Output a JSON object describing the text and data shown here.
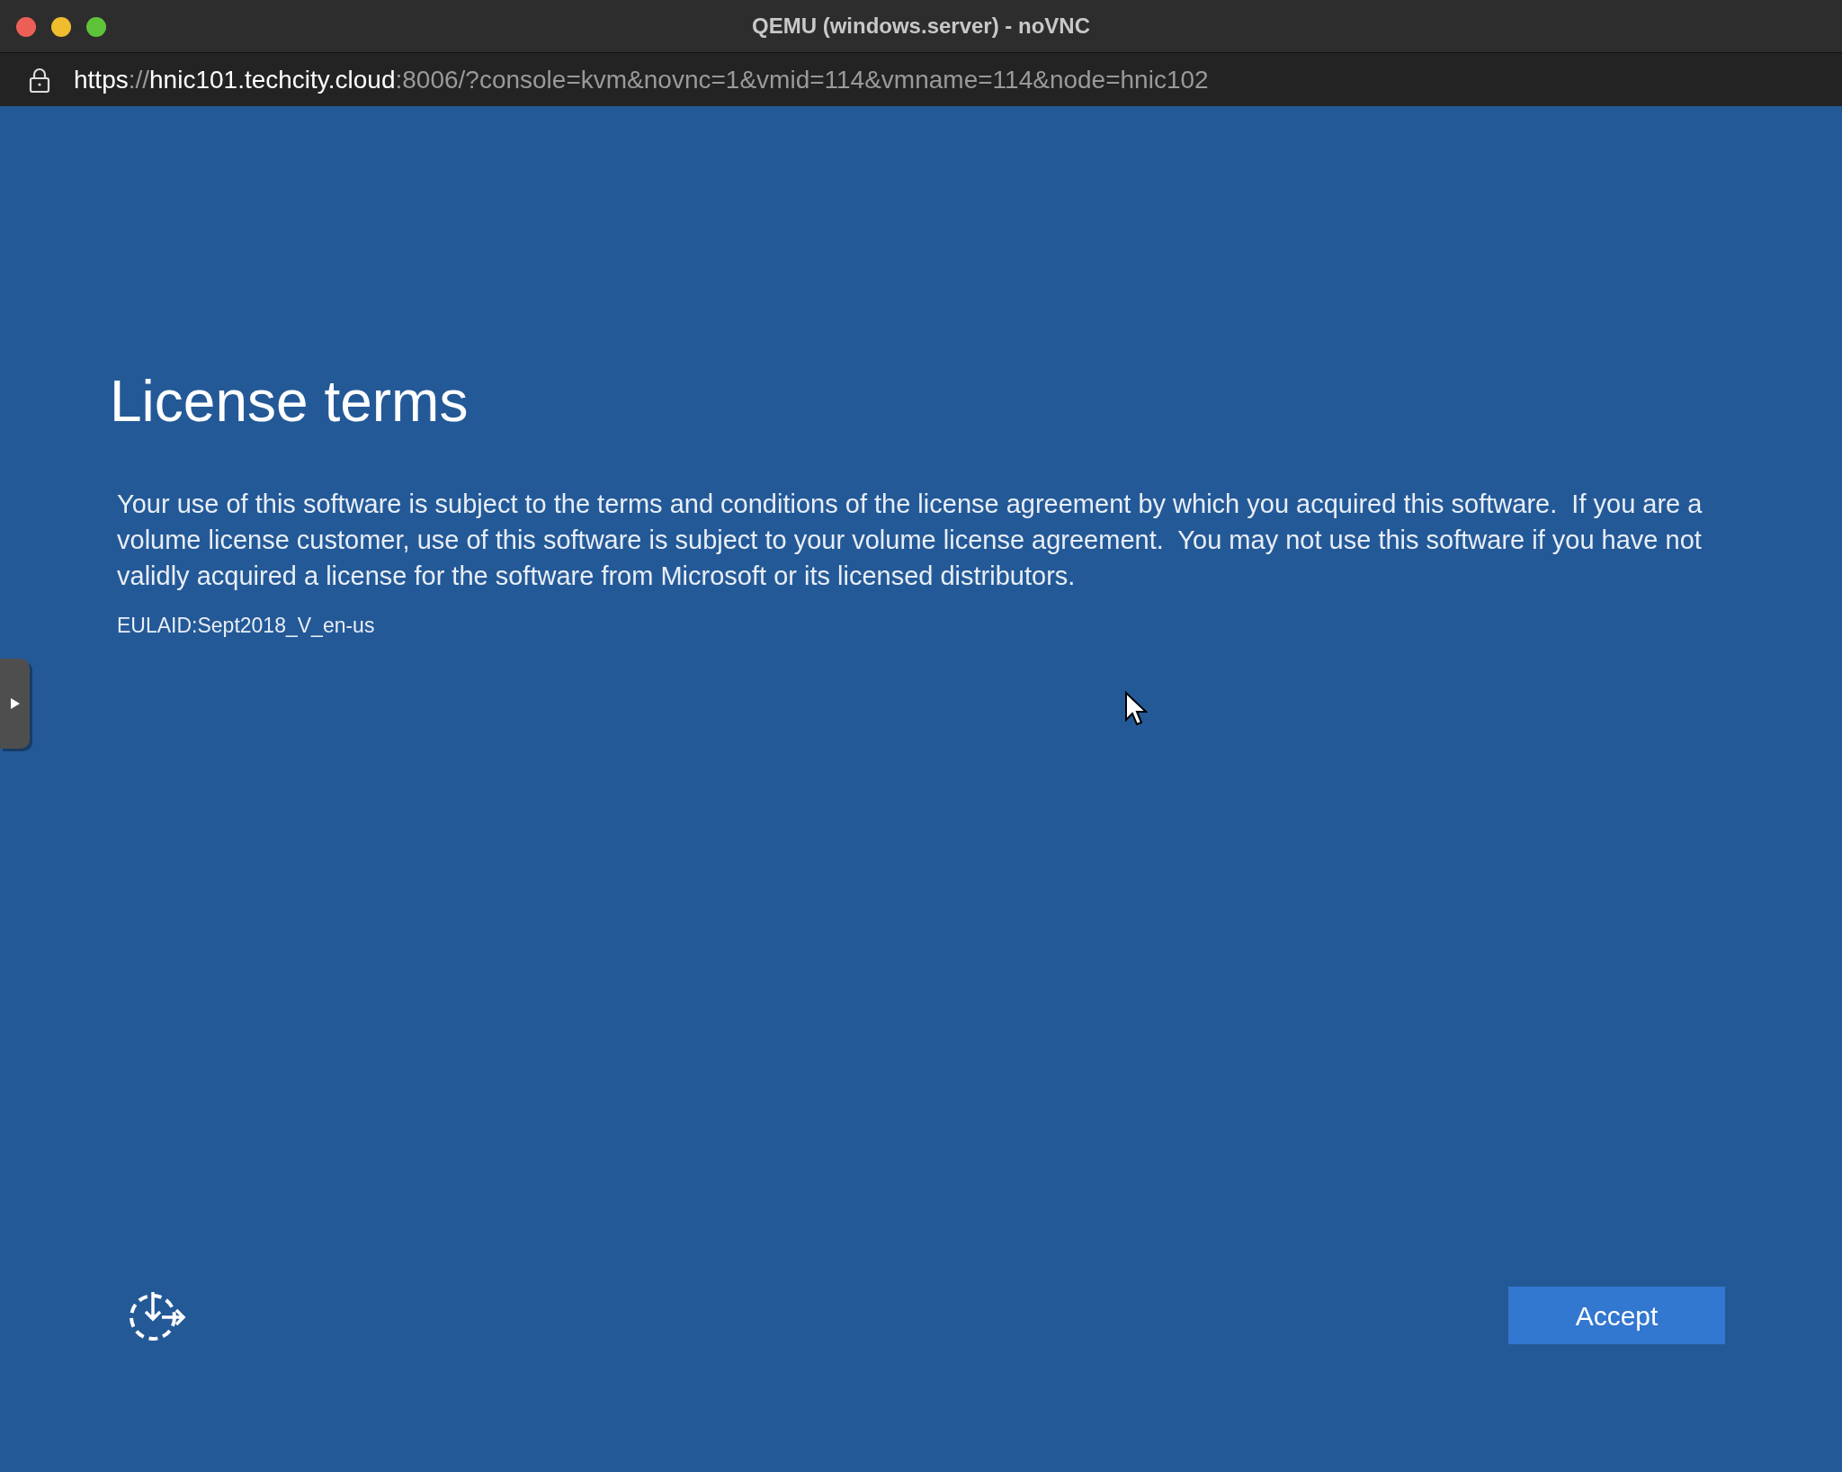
{
  "window": {
    "title": "QEMU (windows.server) - noVNC"
  },
  "address_bar": {
    "url_parts": [
      {
        "text": "https",
        "emphasis": true
      },
      {
        "text": "://",
        "emphasis": false
      },
      {
        "text": "hnic101.techcity.cloud",
        "emphasis": true
      },
      {
        "text": ":8006/?console=kvm&novnc=1&vmid=114&vmname=114&node=hnic102",
        "emphasis": false
      }
    ]
  },
  "setup": {
    "heading": "License terms",
    "body": "Your use of this software is subject to the terms and conditions of the license agreement by which you acquired this software.  If you are a volume license customer, use of this software is subject to your volume license agreement.  You may not use this software if you have not validly acquired a license for the software from Microsoft or its licensed distributors.",
    "eula_id": "EULAID:Sept2018_V_en-us",
    "accept_button": "Accept"
  }
}
